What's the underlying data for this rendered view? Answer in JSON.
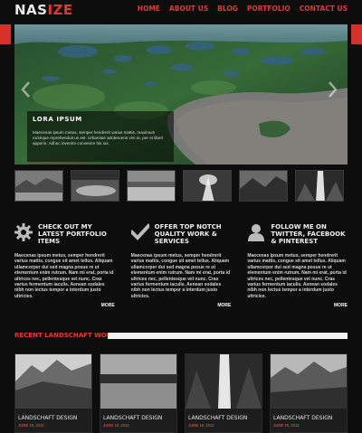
{
  "logo": {
    "part1": "NAS",
    "part2": "IZE"
  },
  "nav": [
    "HOME",
    "ABOUT US",
    "BLOG",
    "PORTFOLIO",
    "CONTACT US"
  ],
  "slider": {
    "caption_title": "LORA IPSUM",
    "caption_text": "Maecenas ipsum metus, semper hendrerit varius mattis, maximum rocteque reprehenduit us est. Urbanitas adolescens vim te, per et liberi apperin. Adhuc invenire convenire his ius.",
    "prev_icon": "chevron-left-icon",
    "next_icon": "chevron-right-icon"
  },
  "features": [
    {
      "icon": "gear-icon",
      "title": "CHECK OUT MY LATEST PORTFOLIO ITEMS",
      "text": "Maecenas ipsum metus, semper hendrerit varius mattis, congue sit amet tellus. Aliquam ullamcorper dui sed magna posue re ut elementum enim rutrum. Nam mi erat, porta id ultrices nec, pellentesque vel nunc. Cras varius fermentum iaculis. Aenean sodales nibh non lectus tempor a interdum justo ultricies.",
      "more": "MORE"
    },
    {
      "icon": "checkmark-icon",
      "title": "OFFER TOP NOTCH QUALITY WORK & SERVICES",
      "text": "Maecenas ipsum metus, semper hendrerit varius mattis, congue sit amet tellus. Aliquam ullamcorper dui sed magna posue re ut elementum enim rutrum. Nam mi erat, porta id ultrices nec, pellentesque vel nunc. Cras varius fermentum iaculis. Aenean sodales nibh non lectus tempor a interdum justo ultricies.",
      "more": "MORE"
    },
    {
      "icon": "user-icon",
      "title": "FOLLOW ME ON TWITTER, FACEBOOK & PINTEREST",
      "text": "Maecenas ipsum metus, semper hendrerit varius mattis, congue sit amet tellus. Aliquam ullamcorper dui sed magna posue re ut elementum enim rutrum. Nam mi erat, porta id ultrices nec, pellentesque vel nunc. Cras varius fermentum iaculis. Aenean sodales nibh non lectus tempor a interdum justo ultricies.",
      "more": "MORE"
    }
  ],
  "recent": {
    "title": "RECENT LANDSCHAFT WORKS",
    "items": [
      {
        "title": "LANDSCHAFT DESIGN",
        "date": "JUNE 19, 2012"
      },
      {
        "title": "LANDSCHAFT DESIGN",
        "date": "JUNE 19, 2012"
      },
      {
        "title": "LANDSCHAFT DESIGN",
        "date": "JUNE 19, 2012"
      },
      {
        "title": "LANDSCHAFT DESIGN",
        "date": "JUNE 19, 2012"
      }
    ]
  },
  "colors": {
    "accent": "#e23a33",
    "background": "#0d0d0d"
  }
}
